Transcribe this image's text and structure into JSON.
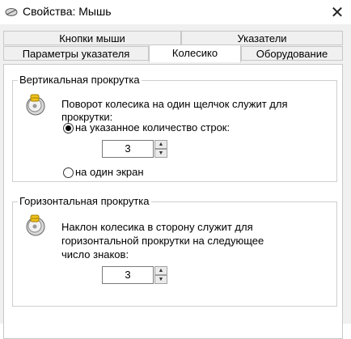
{
  "window": {
    "title": "Свойства: Мышь",
    "close_glyph": "✕"
  },
  "tabs": {
    "row1": [
      "Кнопки мыши",
      "Указатели"
    ],
    "row2": [
      "Параметры указателя",
      "Колесико",
      "Оборудование"
    ],
    "active": "Колесико"
  },
  "vertical": {
    "caption": "Вертикальная прокрутка",
    "description": "Поворот колесика на один щелчок служит для прокрутки:",
    "option_lines": "на указанное количество строк:",
    "option_screen": "на один экран",
    "lines_value": "3",
    "selected_option": "lines"
  },
  "horizontal": {
    "caption": "Горизонтальная прокрутка",
    "description_line1": "Наклон колесика в сторону служит для",
    "description_line2": "горизонтальной прокрутки на следующее",
    "description_line3": "число знаков:",
    "chars_value": "3"
  },
  "icons": {
    "title": "mouse-icon",
    "wheel": "mouse-wheel-icon",
    "spin_up": "▲",
    "spin_down": "▼"
  }
}
